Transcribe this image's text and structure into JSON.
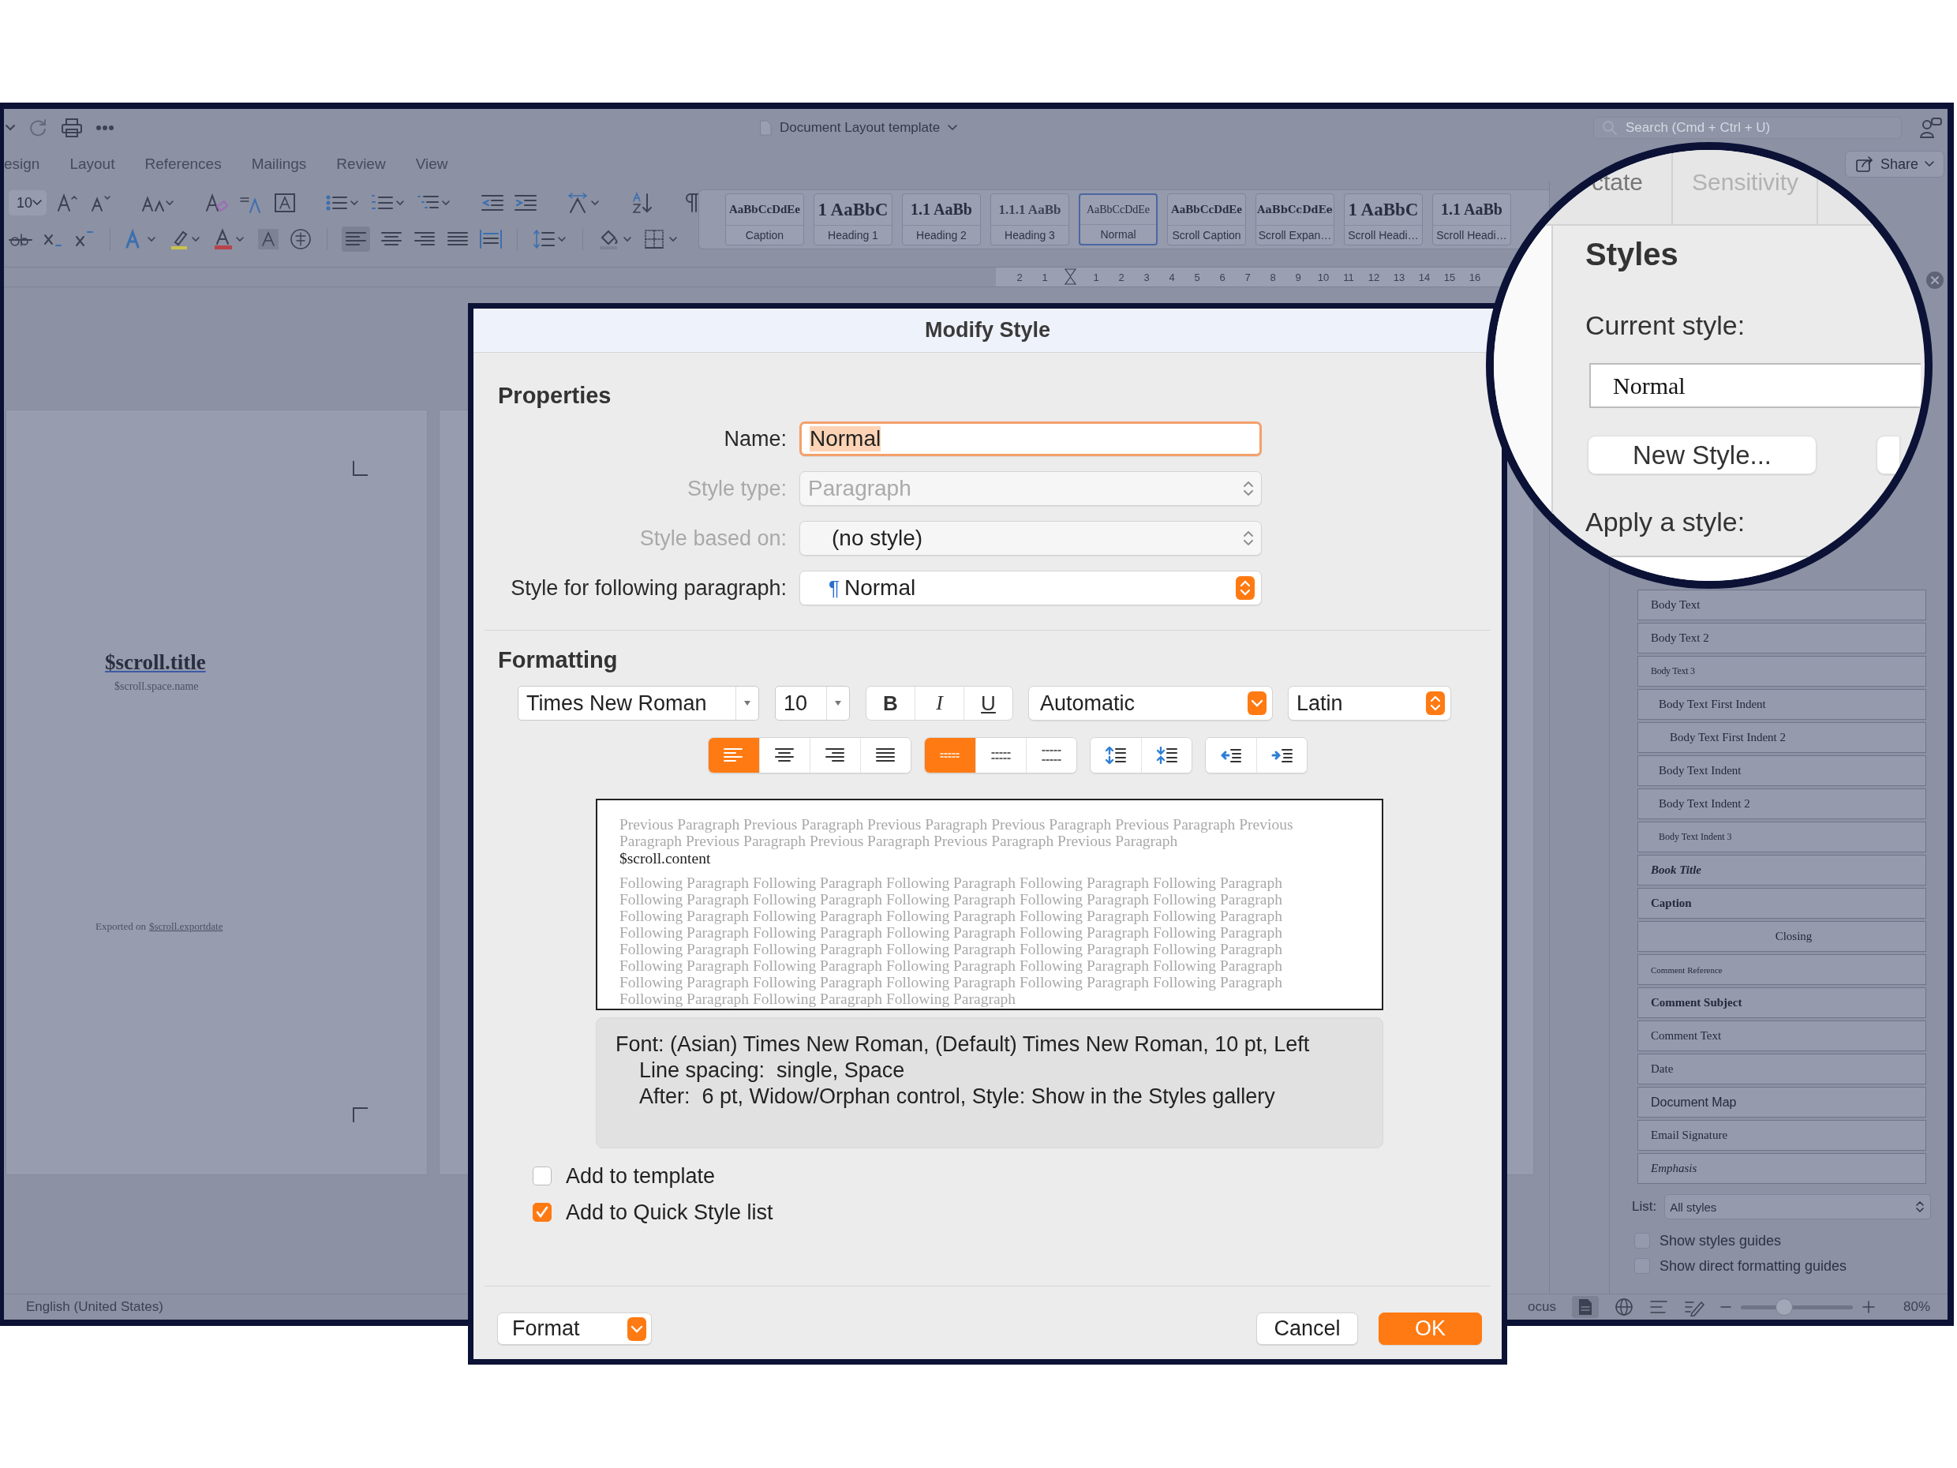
{
  "word_window": {
    "title": "Document Layout template",
    "search": {
      "placeholder": "Search (Cmd + Ctrl + U)"
    },
    "share_button": "Share",
    "ribbon_tabs": [
      "esign",
      "Layout",
      "References",
      "Mailings",
      "Review",
      "View"
    ],
    "font_size": "10",
    "style_gallery": [
      {
        "sample": "AaBbCcDdEe",
        "name": "Caption",
        "kind": "caption",
        "selected": false
      },
      {
        "sample": "1  AaBbC",
        "name": "Heading 1",
        "kind": "heading1",
        "selected": false
      },
      {
        "sample": "1.1  AaBb",
        "name": "Heading 2",
        "kind": "heading2",
        "selected": false
      },
      {
        "sample": "1.1.1  AaBb",
        "name": "Heading 3",
        "kind": "heading3",
        "selected": false
      },
      {
        "sample": "AaBbCcDdEe",
        "name": "Normal",
        "kind": "normal",
        "selected": true
      },
      {
        "sample": "AaBbCcDdEe",
        "name": "Scroll Caption",
        "kind": "caption",
        "selected": false
      },
      {
        "sample": "AaBbCcDdEe",
        "name": "Scroll Expan…",
        "kind": "scroll",
        "selected": false
      },
      {
        "sample": "1  AaBbC",
        "name": "Scroll Headi…",
        "kind": "heading1",
        "selected": false
      },
      {
        "sample": "1.1  AaBb",
        "name": "Scroll Headi…",
        "kind": "heading2",
        "selected": false
      }
    ],
    "ruler_numbers": [
      "2",
      "1",
      "1",
      "2",
      "3",
      "4",
      "5",
      "6",
      "7",
      "8",
      "9",
      "10",
      "11",
      "12",
      "13",
      "14",
      "15",
      "16"
    ],
    "document": {
      "title": "$scroll.title",
      "subtitle": "$scroll.space.name",
      "footer": "Exported on",
      "footer_link": "$scroll.exportdate"
    },
    "styles_pane": {
      "items": [
        {
          "label": "Body Text",
          "kind": "plain"
        },
        {
          "label": "Body Text 2",
          "kind": "plain"
        },
        {
          "label": "Body Text 3",
          "kind": "small"
        },
        {
          "label": "Body Text First Indent",
          "kind": "indent"
        },
        {
          "label": "Body Text First Indent 2",
          "kind": "indent-more"
        },
        {
          "label": "Body Text Indent",
          "kind": "indent"
        },
        {
          "label": "Body Text Indent 2",
          "kind": "indent"
        },
        {
          "label": "Body Text Indent 3",
          "kind": "indent-small"
        },
        {
          "label": "Book Title",
          "kind": "bold-italic"
        },
        {
          "label": "Caption",
          "kind": "bold"
        },
        {
          "label": "Closing",
          "kind": "centered"
        },
        {
          "label": "Comment Reference",
          "kind": "tiny"
        },
        {
          "label": "Comment Subject",
          "kind": "bold"
        },
        {
          "label": "Comment Text",
          "kind": "plain"
        },
        {
          "label": "Date",
          "kind": "plain"
        },
        {
          "label": "Document Map",
          "kind": "sans"
        },
        {
          "label": "Email Signature",
          "kind": "plain"
        },
        {
          "label": "Emphasis",
          "kind": "italic"
        }
      ],
      "list_label": "List:",
      "list_value": "All styles",
      "options": [
        {
          "label": "Show styles guides",
          "checked": false
        },
        {
          "label": "Show direct formatting guides",
          "checked": false
        }
      ]
    },
    "status_bar": {
      "language": "English (United States)",
      "focus": "ocus",
      "zoom_slider": {
        "level": 0.39
      },
      "zoom": "80%"
    }
  },
  "dialog": {
    "title": "Modify Style",
    "properties": {
      "heading": "Properties",
      "fields": [
        {
          "label": "Name:",
          "kind": "text",
          "value": "Normal",
          "disabled": false,
          "focused": true,
          "text_selected": true,
          "value_dimmed": false
        },
        {
          "label": "Style type:",
          "kind": "stepper",
          "value": "Paragraph",
          "disabled": true,
          "focused": false,
          "text_selected": false,
          "value_dimmed": true
        },
        {
          "label": "Style based on:",
          "kind": "stepper",
          "value": "(no style)",
          "disabled": true,
          "focused": false,
          "text_selected": false,
          "value_dimmed": false
        },
        {
          "label": "Style for following paragraph:",
          "kind": "accent-stepper",
          "mark": "¶",
          "value": "Normal",
          "disabled": false,
          "focused": false,
          "text_selected": false,
          "value_dimmed": false
        }
      ]
    },
    "formatting": {
      "heading": "Formatting",
      "font": "Times New Roman",
      "size": "10",
      "text_styles": [
        {
          "label": "B",
          "kind": "bold"
        },
        {
          "label": "I",
          "kind": "italic"
        },
        {
          "label": "U",
          "kind": "underline"
        }
      ],
      "font_color": "Automatic",
      "script": "Latin",
      "alignment": [
        {
          "kind": "left",
          "selected": true
        },
        {
          "kind": "center",
          "selected": false
        },
        {
          "kind": "right",
          "selected": false
        },
        {
          "kind": "justify",
          "selected": false
        }
      ],
      "line_spacing": [
        {
          "kind": "single",
          "selected": true
        },
        {
          "kind": "one-half",
          "selected": false
        },
        {
          "kind": "double",
          "selected": false
        }
      ],
      "paragraph_spacing": [
        {
          "kind": "before"
        },
        {
          "kind": "after"
        }
      ],
      "indent": [
        {
          "kind": "decrease"
        },
        {
          "kind": "increase"
        }
      ]
    },
    "preview": {
      "previous": [
        "Previous Paragraph Previous Paragraph Previous Paragraph Previous Paragraph Previous Paragraph Previous",
        "Paragraph Previous Paragraph Previous Paragraph Previous Paragraph Previous Paragraph"
      ],
      "content": "$scroll.content",
      "following": [
        "Following Paragraph Following Paragraph Following Paragraph Following Paragraph Following Paragraph",
        "Following Paragraph Following Paragraph Following Paragraph Following Paragraph Following Paragraph",
        "Following Paragraph Following Paragraph Following Paragraph Following Paragraph Following Paragraph",
        "Following Paragraph Following Paragraph Following Paragraph Following Paragraph Following Paragraph",
        "Following Paragraph Following Paragraph Following Paragraph Following Paragraph Following Paragraph",
        "Following Paragraph Following Paragraph Following Paragraph Following Paragraph Following Paragraph",
        "Following Paragraph Following Paragraph Following Paragraph Following Paragraph Following Paragraph",
        "Following Paragraph Following Paragraph Following Paragraph"
      ]
    },
    "description": [
      "Font: (Asian) Times New Roman, (Default) Times New Roman, 10 pt, Left",
      "Line spacing:  single, Space",
      "After:  6 pt, Widow/Orphan control, Style: Show in the Styles gallery"
    ],
    "checkboxes": [
      {
        "label": "Add to template",
        "checked": false
      },
      {
        "label": "Add to Quick Style list",
        "checked": true
      }
    ],
    "format_button": "Format",
    "cancel_button": "Cancel",
    "ok_button": "OK"
  },
  "magnifier": {
    "tabs": [
      {
        "label": "ctate",
        "disabled": false
      },
      {
        "label": "Sensitivity",
        "disabled": true
      }
    ],
    "title": "Styles",
    "current_style_label": "Current style:",
    "current_style": "Normal",
    "new_style_button": "New Style...",
    "apply_label": "Apply a style:"
  }
}
